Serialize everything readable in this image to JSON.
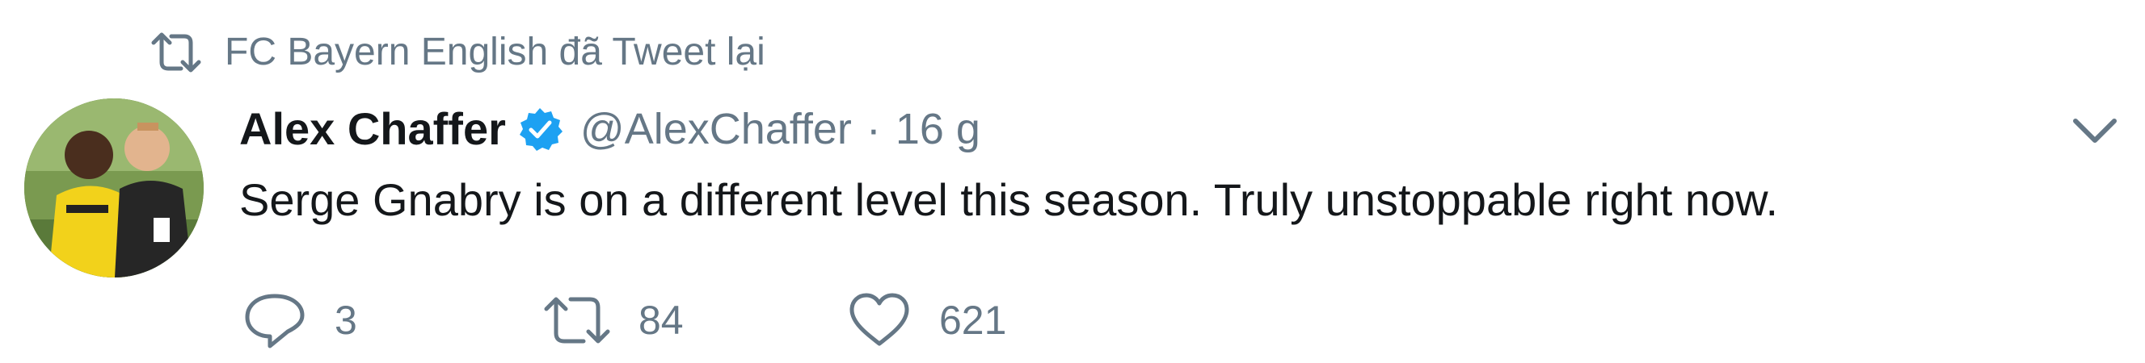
{
  "context": {
    "text": "FC Bayern English đã Tweet lại",
    "icon": "retweet-icon"
  },
  "author": {
    "name": "Alex Chaffer",
    "verified": true,
    "handle": "@AlexChaffer",
    "separator": "·",
    "time": "16 g"
  },
  "tweet": {
    "text": "Serge Gnabry is on a different level this season. Truly unstoppable right now."
  },
  "actions": {
    "reply": {
      "icon": "reply-icon",
      "count": "3"
    },
    "retweet": {
      "icon": "retweet-icon",
      "count": "84"
    },
    "like": {
      "icon": "heart-icon",
      "count": "621"
    }
  },
  "menu": {
    "icon": "chevron-down-icon"
  },
  "colors": {
    "text": "#14171a",
    "muted": "#657786",
    "verified": "#1da1f2"
  }
}
